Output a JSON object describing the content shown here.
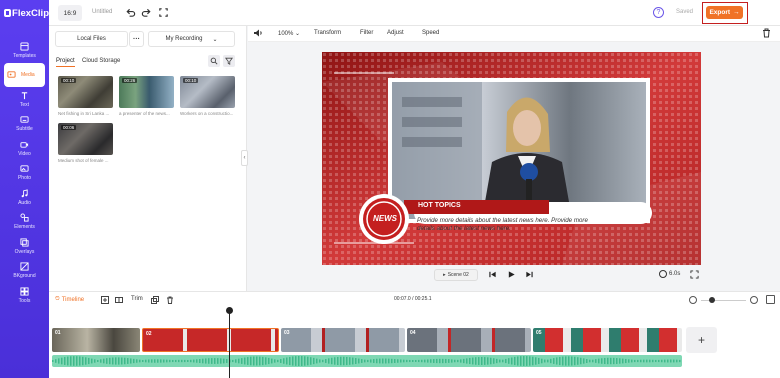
{
  "app": {
    "logo_text": "FlexClip",
    "aspect_ratio": "16:9",
    "project_name": "Untitled",
    "saved_status": "Saved",
    "export_label": "Export",
    "help_label": "?"
  },
  "sidebar": {
    "items": [
      {
        "label": "Templates",
        "icon": "templates-icon"
      },
      {
        "label": "Media",
        "icon": "media-icon"
      },
      {
        "label": "Text",
        "icon": "text-icon"
      },
      {
        "label": "Subtitle",
        "icon": "subtitle-icon"
      },
      {
        "label": "Video",
        "icon": "video-icon"
      },
      {
        "label": "Photo",
        "icon": "photo-icon"
      },
      {
        "label": "Audio",
        "icon": "audio-icon"
      },
      {
        "label": "Elements",
        "icon": "elements-icon"
      },
      {
        "label": "Overlays",
        "icon": "overlays-icon"
      },
      {
        "label": "BKground",
        "icon": "background-icon"
      },
      {
        "label": "Tools",
        "icon": "tools-icon"
      }
    ],
    "active": "Media"
  },
  "media_panel": {
    "local_files_label": "Local Files",
    "more_label": "···",
    "recording_label": "My Recording",
    "tabs": [
      "Project",
      "Cloud Storage"
    ],
    "active_tab": "Project",
    "items": [
      {
        "duration": "00:10",
        "label": "Net fishing in Sri Lanka ..."
      },
      {
        "duration": "00:26",
        "label": "a presenter of the news..."
      },
      {
        "duration": "00:10",
        "label": "Workers on a constructio..."
      },
      {
        "duration": "00:06",
        "label": "Medium shot of female ..."
      }
    ]
  },
  "edit_toolbar": {
    "zoom": "100%",
    "items": [
      "Transform",
      "Filter",
      "Adjust",
      "Speed"
    ]
  },
  "preview": {
    "headline": "HOT TOPICS",
    "badge": "NEWS",
    "body_text": "Provide more details about the latest news here. Provide more details about the latest news here."
  },
  "playback": {
    "scene_label": "Scene 02",
    "duration": "6.0s"
  },
  "timeline": {
    "label": "Timeline",
    "trim_label": "Trim",
    "time_display": "00:07.0 / 00:25.1",
    "clips": [
      {
        "num": "01"
      },
      {
        "num": "02"
      },
      {
        "num": "03"
      },
      {
        "num": "04"
      },
      {
        "num": "05"
      }
    ],
    "add_label": "+"
  },
  "colors": {
    "brand": "#5b3ef0",
    "accent": "#f07226",
    "news_red": "#c41f1f",
    "audio_wave": "#7fd8b4"
  }
}
